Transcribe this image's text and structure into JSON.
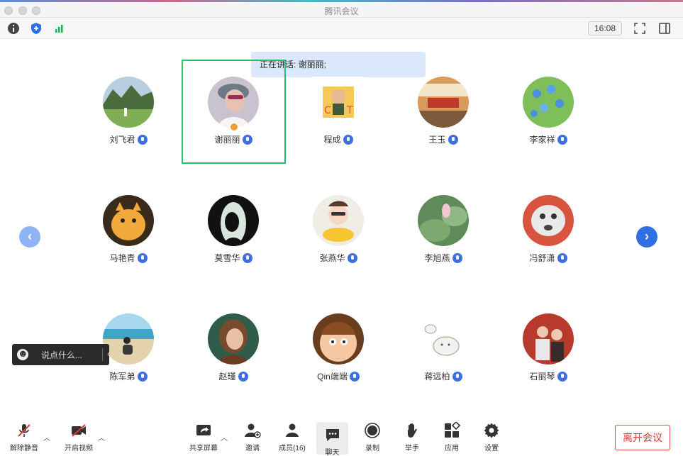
{
  "window": {
    "title": "腾讯会议"
  },
  "toolbar": {
    "time": "16:08"
  },
  "speaking": {
    "label": "正在讲话: ",
    "names": "谢丽丽;"
  },
  "participants": [
    {
      "name": "刘飞君",
      "row": 1
    },
    {
      "name": "谢丽丽",
      "row": 1,
      "host": true,
      "active": true
    },
    {
      "name": "程成",
      "row": 1
    },
    {
      "name": "王玉",
      "row": 1
    },
    {
      "name": "李家祥",
      "row": 1
    },
    {
      "name": "马艳青",
      "row": 2
    },
    {
      "name": "莫雪华",
      "row": 2
    },
    {
      "name": "张燕华",
      "row": 2
    },
    {
      "name": "李旭燕",
      "row": 2
    },
    {
      "name": "冯舒潇",
      "row": 2
    },
    {
      "name": "陈军弟",
      "row": 3
    },
    {
      "name": "赵瑾",
      "row": 3
    },
    {
      "name": "Qin端端",
      "row": 3
    },
    {
      "name": "蒋远柏",
      "row": 3
    },
    {
      "name": "石丽琴",
      "row": 3
    }
  ],
  "chat_input": {
    "placeholder": "说点什么..."
  },
  "bottom_bar": {
    "unmute": "解除静音",
    "start_video": "开启视频",
    "share_screen": "共享屏幕",
    "invite": "邀请",
    "members": "成员(16)",
    "chat": "聊天",
    "record": "录制",
    "raise_hand": "举手",
    "apps": "应用",
    "settings": "设置",
    "leave": "离开会议"
  },
  "colors": {
    "accent": "#3d6fe0",
    "active_border": "#2bbd6b",
    "leave": "#e03636"
  }
}
